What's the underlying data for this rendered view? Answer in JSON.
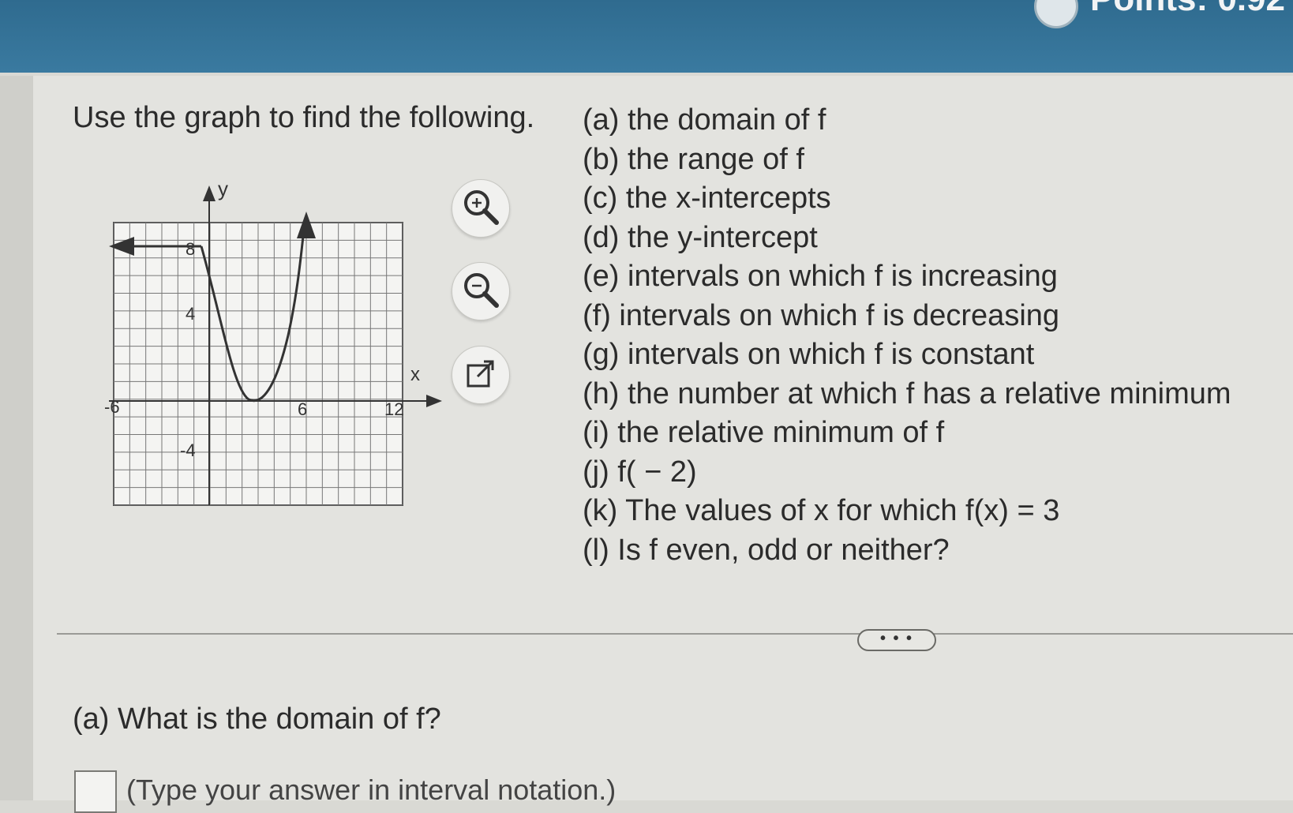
{
  "header": {
    "points_text": "Points: 0.92"
  },
  "problem": {
    "intro": "Use the graph to find the following.",
    "items": [
      "(a) the domain of f",
      "(b) the range of f",
      "(c) the x-intercepts",
      "(d) the y-intercept",
      "(e) intervals on which f is increasing",
      "(f) intervals on which f is decreasing",
      "(g) intervals on which f is constant",
      "(h) the number at which f has a relative minimum",
      "(i) the relative minimum of f",
      "(j) f( − 2)",
      "(k) The values of x for which f(x) = 3",
      "(l) Is f even, odd or neither?"
    ]
  },
  "graph": {
    "y_axis_label": "y",
    "x_axis_label": "x",
    "x_tick_labels": [
      "-6",
      "6",
      "12"
    ],
    "y_tick_labels": [
      "8",
      "4",
      "-4"
    ]
  },
  "tools": {
    "zoom_in_icon": "zoom-in-icon",
    "zoom_out_icon": "zoom-out-icon",
    "popout_icon": "external-link-icon"
  },
  "more_button": "• • •",
  "part_a": {
    "question": "(a) What is the domain of f?",
    "hint": "(Type your answer in interval notation.)"
  }
}
